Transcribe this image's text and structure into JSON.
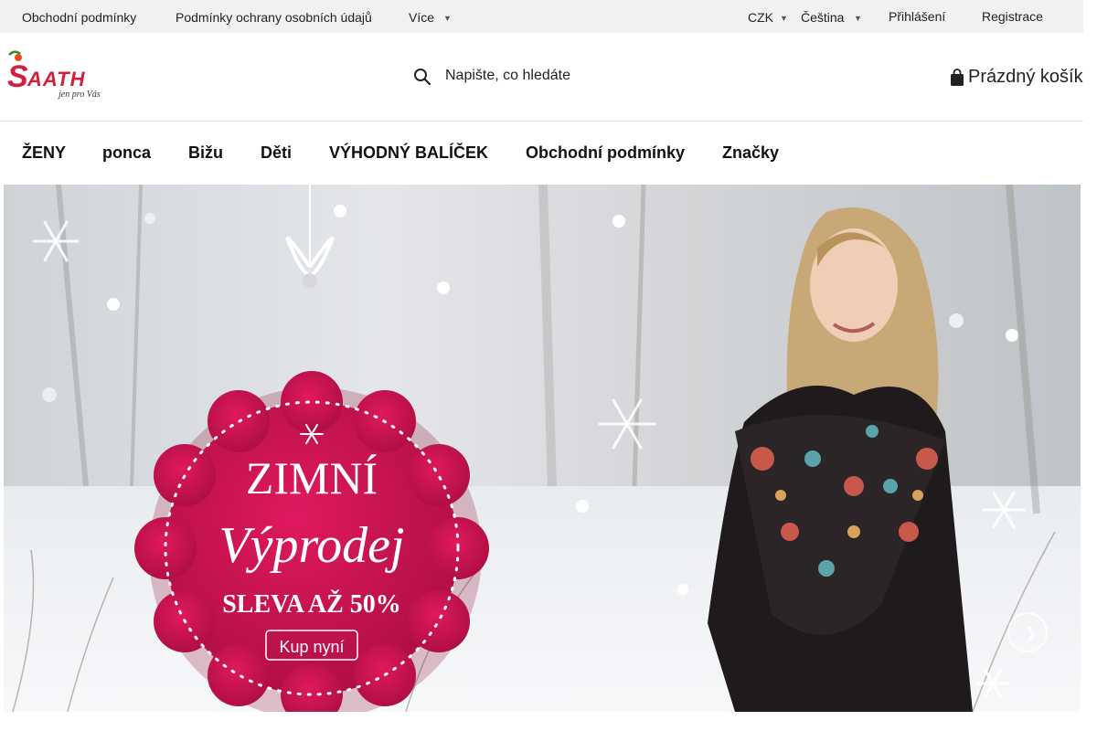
{
  "topbar": {
    "links": [
      "Obchodní podmínky",
      "Podmínky ochrany osobních údajů",
      "Více"
    ],
    "currency": "CZK",
    "language": "Čeština",
    "login": "Přihlášení",
    "register": "Registrace"
  },
  "header": {
    "logo_text": "SAATH",
    "logo_tagline": "jen pro Vás",
    "search_placeholder": "Napište, co hledáte",
    "cart_label": "Prázdný košík"
  },
  "nav": {
    "items": [
      "ŽENY",
      "ponca",
      "Bižu",
      "Děti",
      "VÝHODNÝ BALÍČEK",
      "Obchodní podmínky",
      "Značky"
    ]
  },
  "banner": {
    "title_line1": "ZIMNÍ",
    "title_line2": "Výprodej",
    "discount": "SLEVA AŽ 50%",
    "cta": "Kup nyní"
  },
  "colors": {
    "topbar_bg": "#f1f1f1",
    "badge": "#c8124e",
    "logo_red": "#d31f3c"
  }
}
